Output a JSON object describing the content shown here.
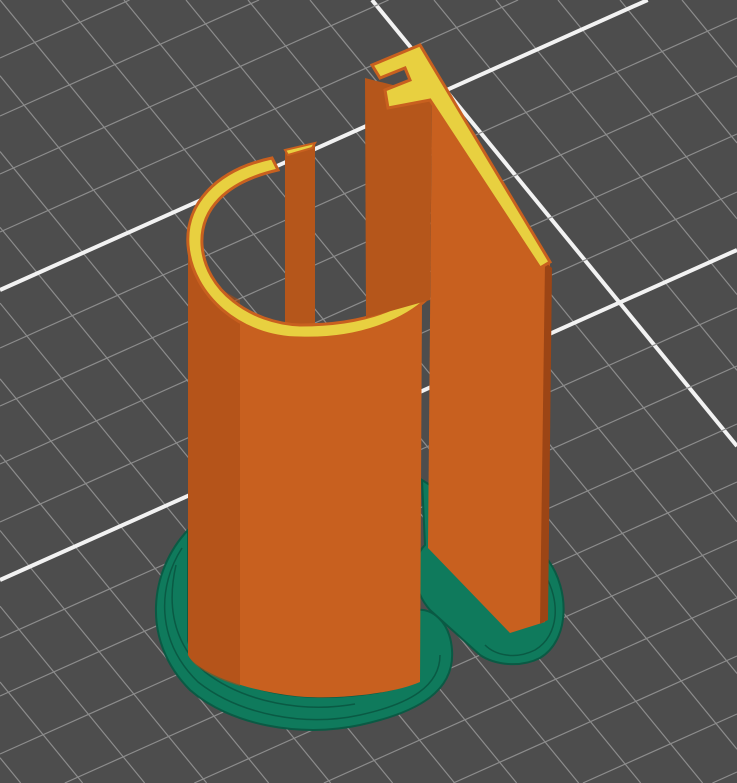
{
  "viewport": {
    "title": "",
    "colors": {
      "background": "#4d4d4d",
      "grid_minor": "#8c8c8c",
      "grid_major": "#f2f2f2",
      "perimeter": "#c8601f",
      "perimeter_shadow": "#9c4515",
      "top_infill": "#e8d040",
      "skirt": "#0f7a5c",
      "skirt_line": "#0a5a44"
    }
  }
}
